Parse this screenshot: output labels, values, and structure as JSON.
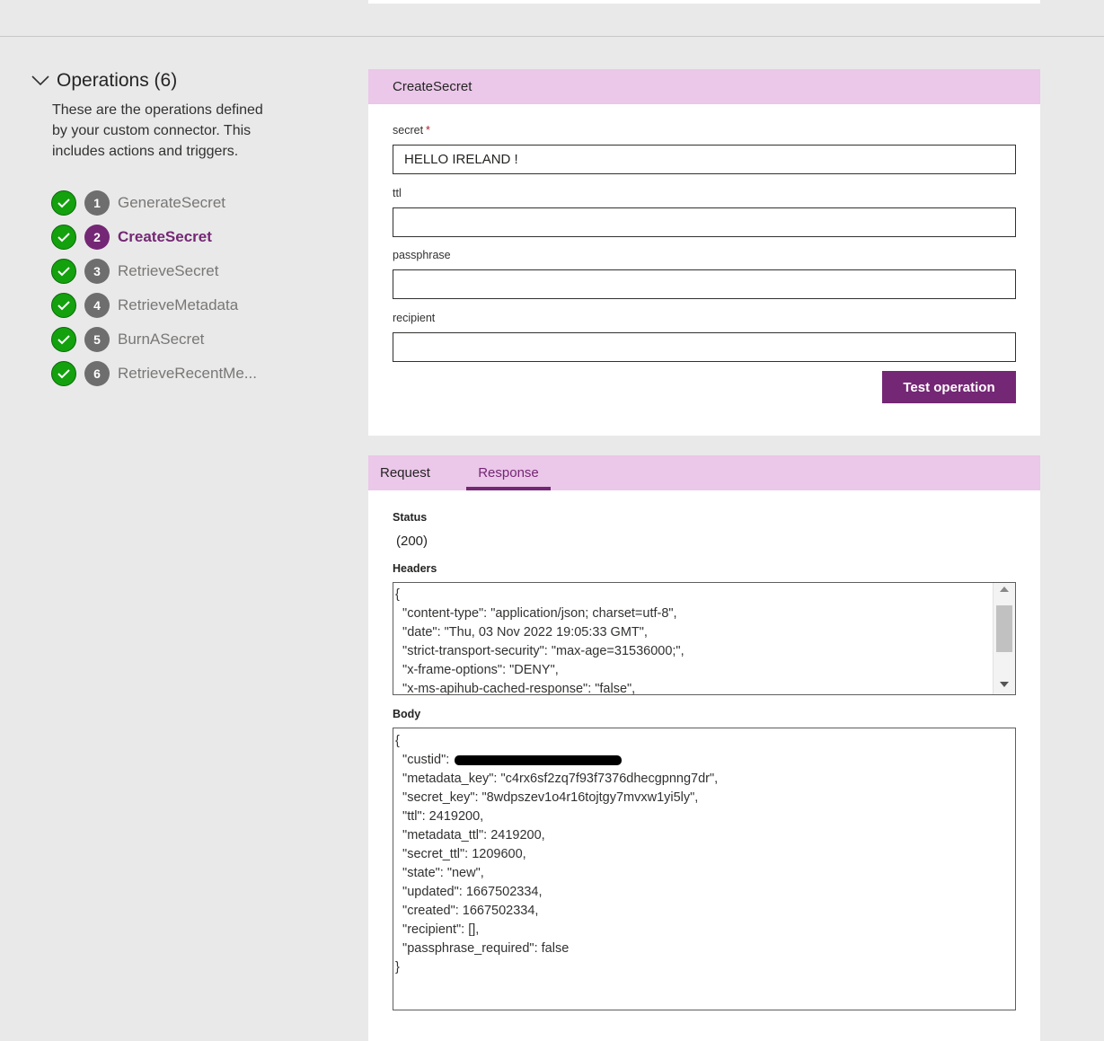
{
  "operations": {
    "title": "Operations (6)",
    "description": "These are the operations defined by your custom connector. This includes actions and triggers.",
    "items": [
      {
        "num": "1",
        "label": "GenerateSecret"
      },
      {
        "num": "2",
        "label": "CreateSecret"
      },
      {
        "num": "3",
        "label": "RetrieveSecret"
      },
      {
        "num": "4",
        "label": "RetrieveMetadata"
      },
      {
        "num": "5",
        "label": "BurnASecret"
      },
      {
        "num": "6",
        "label": "RetrieveRecentMe..."
      }
    ],
    "active_index": 1
  },
  "form": {
    "title": "CreateSecret",
    "fields": {
      "secret": {
        "label": "secret",
        "required_mark": "*",
        "value": "HELLO IRELAND !"
      },
      "ttl": {
        "label": "ttl",
        "value": ""
      },
      "passphrase": {
        "label": "passphrase",
        "value": ""
      },
      "recipient": {
        "label": "recipient",
        "value": ""
      }
    },
    "test_button": "Test operation"
  },
  "response": {
    "tabs": {
      "request": "Request",
      "response": "Response"
    },
    "active_tab": "Response",
    "status_label": "Status",
    "status_value": "(200)",
    "headers_label": "Headers",
    "headers_lines": [
      "{",
      "  \"content-type\": \"application/json; charset=utf-8\",",
      "  \"date\": \"Thu, 03 Nov 2022 19:05:33 GMT\",",
      "  \"strict-transport-security\": \"max-age=31536000;\",",
      "  \"x-frame-options\": \"DENY\",",
      "  \"x-ms-apihub-cached-response\": \"false\","
    ],
    "body_label": "Body",
    "body_first_line": "{",
    "body_custid_key": "  \"custid\": ",
    "body_lines": [
      "  \"metadata_key\": \"c4rx6sf2zq7f93f7376dhecgpnng7dr\",",
      "  \"secret_key\": \"8wdpszev1o4r16tojtgy7mvxw1yi5ly\",",
      "  \"ttl\": 2419200,",
      "  \"metadata_ttl\": 2419200,",
      "  \"secret_ttl\": 1209600,",
      "  \"state\": \"new\",",
      "  \"updated\": 1667502334,",
      "  \"created\": 1667502334,",
      "  \"recipient\": [],",
      "  \"passphrase_required\": false",
      "}"
    ]
  },
  "colors": {
    "accent": "#742774",
    "header_band": "#ebc7e9",
    "success": "#13a10e",
    "badge_inactive": "#6e6e6e"
  }
}
